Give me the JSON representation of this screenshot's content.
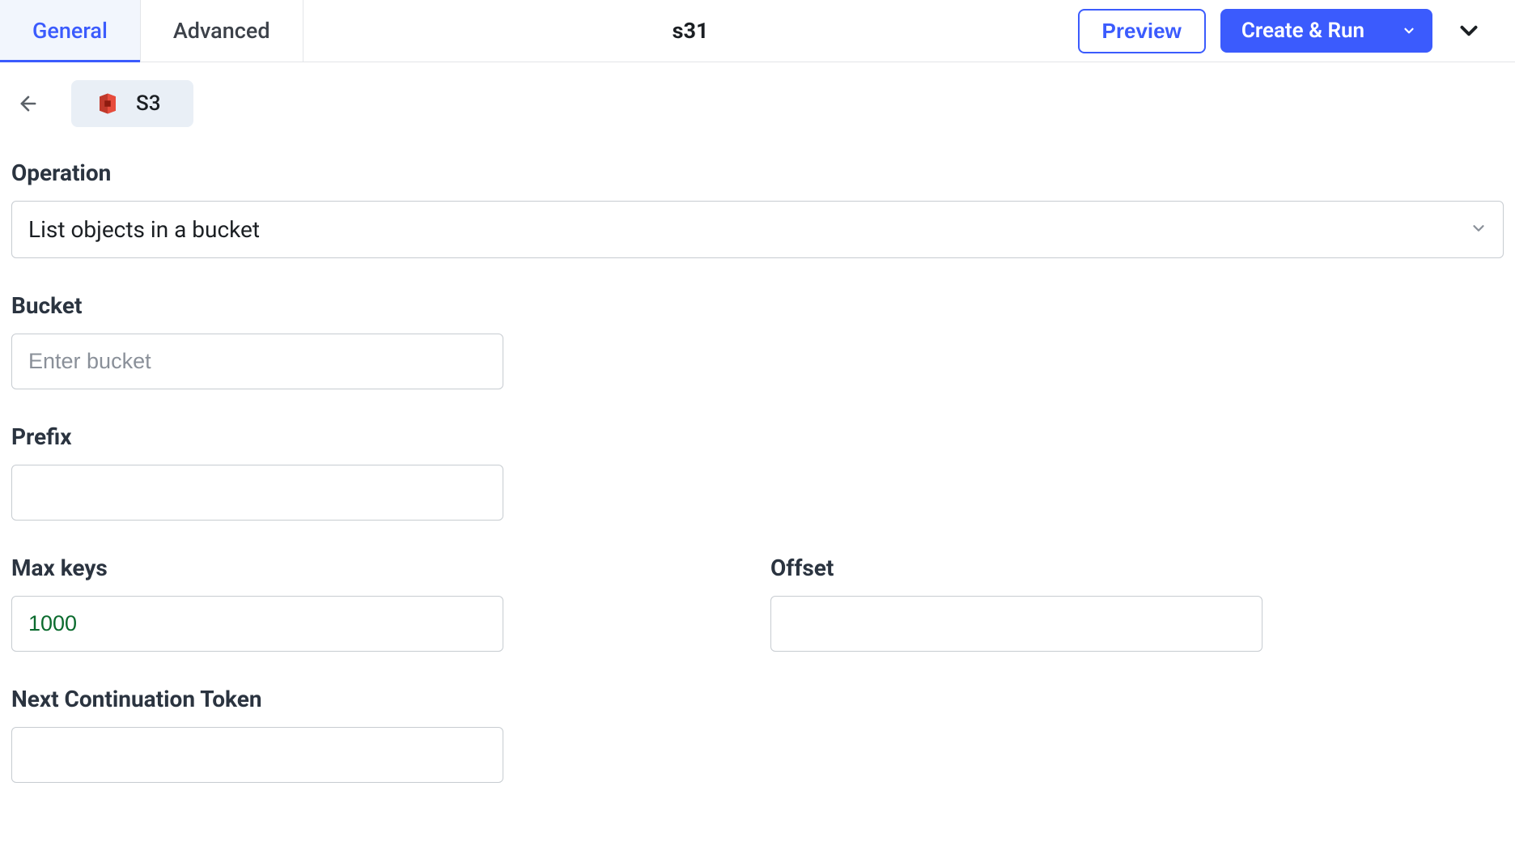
{
  "tabs": {
    "general": "General",
    "advanced": "Advanced"
  },
  "header": {
    "title": "s31",
    "preview": "Preview",
    "createRun": "Create & Run"
  },
  "breadcrumb": {
    "componentName": "S3"
  },
  "form": {
    "operation": {
      "label": "Operation",
      "value": "List objects in a bucket"
    },
    "bucket": {
      "label": "Bucket",
      "placeholder": "Enter bucket",
      "value": ""
    },
    "prefix": {
      "label": "Prefix",
      "value": ""
    },
    "maxKeys": {
      "label": "Max keys",
      "value": "1000"
    },
    "offset": {
      "label": "Offset",
      "value": ""
    },
    "nextToken": {
      "label": "Next Continuation Token",
      "value": ""
    }
  }
}
